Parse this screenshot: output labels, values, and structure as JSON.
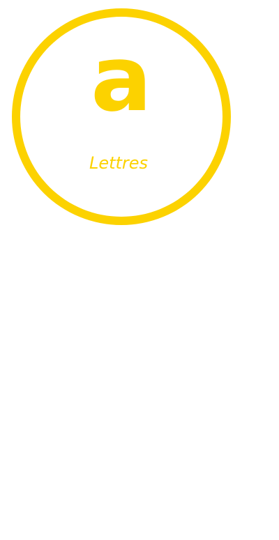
{
  "category": {
    "glyph": "a",
    "label": "Lettres"
  },
  "colors": {
    "accent": "#fcd200",
    "background": "#ffffff"
  }
}
